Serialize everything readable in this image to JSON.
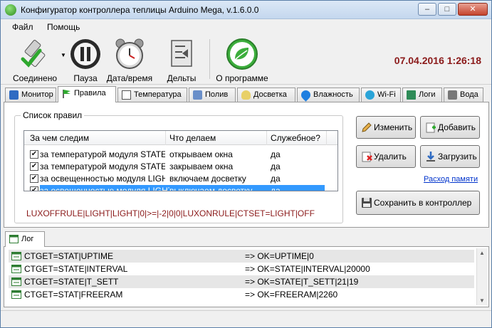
{
  "window": {
    "title": "Конфигуратор контроллера теплицы Arduino Mega, v.1.6.0.0",
    "minimize_glyph": "–",
    "maximize_glyph": "□",
    "close_glyph": "✕"
  },
  "menu": {
    "items": [
      "Файл",
      "Помощь"
    ]
  },
  "toolbar": {
    "buttons": [
      {
        "label": "Соединено",
        "icon": "usb-connected-icon"
      },
      {
        "label": "Пауза",
        "icon": "pause-icon"
      },
      {
        "label": "Дата/время",
        "icon": "alarm-clock-icon"
      },
      {
        "label": "Дельты",
        "icon": "deltas-icon"
      },
      {
        "label": "О программе",
        "icon": "leaf-logo-icon"
      }
    ],
    "datetime": "07.04.2016 1:26:18"
  },
  "tabs": [
    {
      "label": "Монитор",
      "icon": "monitor-icon"
    },
    {
      "label": "Правила",
      "icon": "flag-icon",
      "active": true
    },
    {
      "label": "Температура",
      "icon": "thermometer-icon"
    },
    {
      "label": "Полив",
      "icon": "watering-icon"
    },
    {
      "label": "Досветка",
      "icon": "lamp-icon"
    },
    {
      "label": "Влажность",
      "icon": "drop-icon"
    },
    {
      "label": "Wi-Fi",
      "icon": "wifi-icon"
    },
    {
      "label": "Логи",
      "icon": "log-icon"
    },
    {
      "label": "Вода",
      "icon": "water-icon"
    }
  ],
  "rules": {
    "group_title": "Список правил",
    "columns": [
      "За чем следим",
      "Что делаем",
      "Служебное?"
    ],
    "rows": [
      {
        "checked": true,
        "watch": "за температурой модуля STATE",
        "action": "открываем окна",
        "service": "да"
      },
      {
        "checked": true,
        "watch": "за температурой модуля STATE",
        "action": "закрываем окна",
        "service": "да"
      },
      {
        "checked": true,
        "watch": "за освещенностью модуля LIGHT",
        "action": "включаем досветку",
        "service": "да"
      },
      {
        "checked": true,
        "watch": "за освещенностью модуля LIGHT",
        "action": "выключаем досветку",
        "service": "да",
        "selected": true
      }
    ],
    "rule_string": "LUXOFFRULE|LIGHT|LIGHT|0|>=|-2|0|0|LUXONRULE|CTSET=LIGHT|OFF"
  },
  "actions": {
    "edit": "Изменить",
    "add": "Добавить",
    "delete": "Удалить",
    "load": "Загрузить",
    "memory_link": "Расход памяти",
    "save": "Сохранить в контроллер"
  },
  "log": {
    "tab_label": "Лог",
    "rows": [
      {
        "cmd": "CTGET=STAT|UPTIME",
        "resp": "=> OK=UPTIME|0"
      },
      {
        "cmd": "CTGET=STATE|INTERVAL",
        "resp": "=> OK=STATE|INTERVAL|20000"
      },
      {
        "cmd": "CTGET=STATE|T_SETT",
        "resp": "=> OK=STATE|T_SETT|21|19"
      },
      {
        "cmd": "CTGET=STAT|FREERAM",
        "resp": "=> OK=FREERAM|2260"
      }
    ]
  },
  "colors": {
    "datetime": "#8b1a1a",
    "selection": "#3399ff",
    "rule_string": "#8b1a1a",
    "link": "#0033cc"
  }
}
